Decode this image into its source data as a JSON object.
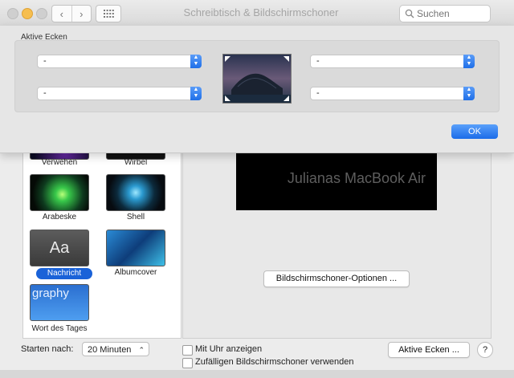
{
  "window": {
    "title": "Schreibtisch & Bildschirmschoner",
    "search_placeholder": "Suchen"
  },
  "colors": {
    "accent": "#1a62d8",
    "ok_button": "#1b6ce9"
  },
  "icons": {
    "back": "chevron-left-icon",
    "forward": "chevron-right-icon",
    "grid": "grid-icon",
    "search": "search-icon"
  },
  "screensavers": [
    {
      "label": "Verwehen"
    },
    {
      "label": "Wirbel"
    },
    {
      "label": "Arabeske"
    },
    {
      "label": "Shell"
    },
    {
      "label": "Nachricht",
      "selected": true,
      "thumb_text": "Aa"
    },
    {
      "label": "Albumcover"
    },
    {
      "label": "Wort des Tages",
      "thumb_text": "graphy"
    }
  ],
  "preview": {
    "text": "Julianas MacBook Air"
  },
  "options_button": "Bildschirmschoner-Optionen ...",
  "start": {
    "label": "Starten nach:",
    "value": "20 Minuten"
  },
  "checkboxes": {
    "clock": "Mit Uhr anzeigen",
    "random": "Zufälligen Bildschirmschoner verwenden"
  },
  "hot_corners_button": "Aktive Ecken ...",
  "help_button": "?",
  "sheet": {
    "group_label": "Aktive Ecken",
    "top_left": "-",
    "top_right": "-",
    "bottom_left": "-",
    "bottom_right": "-",
    "ok": "OK"
  }
}
